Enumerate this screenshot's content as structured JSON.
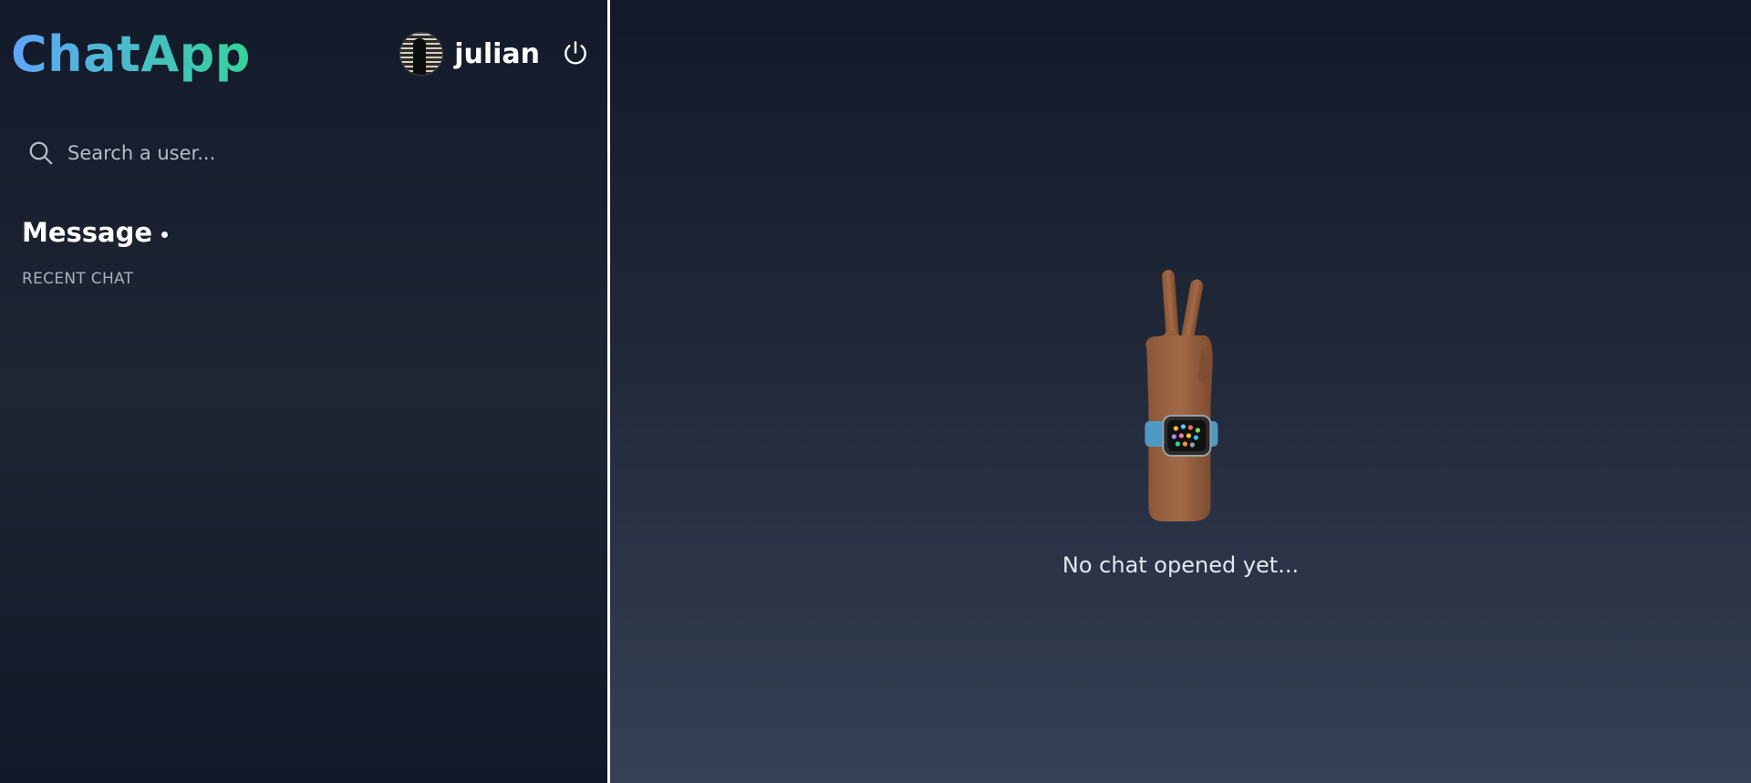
{
  "app": {
    "logo": "ChatApp"
  },
  "user": {
    "name": "julian"
  },
  "search": {
    "placeholder": "Search a user..."
  },
  "sidebar": {
    "section_title": "Message",
    "subsection_label": "RECENT CHAT"
  },
  "main": {
    "empty_message": "No chat opened yet..."
  },
  "icons": {
    "search": "search-icon",
    "logout": "power-icon",
    "illustration": "peace-hand-watch-illustration"
  },
  "colors": {
    "logo_gradient_start": "#60a5fa",
    "logo_gradient_end": "#34d399",
    "divider": "#ffffff"
  }
}
